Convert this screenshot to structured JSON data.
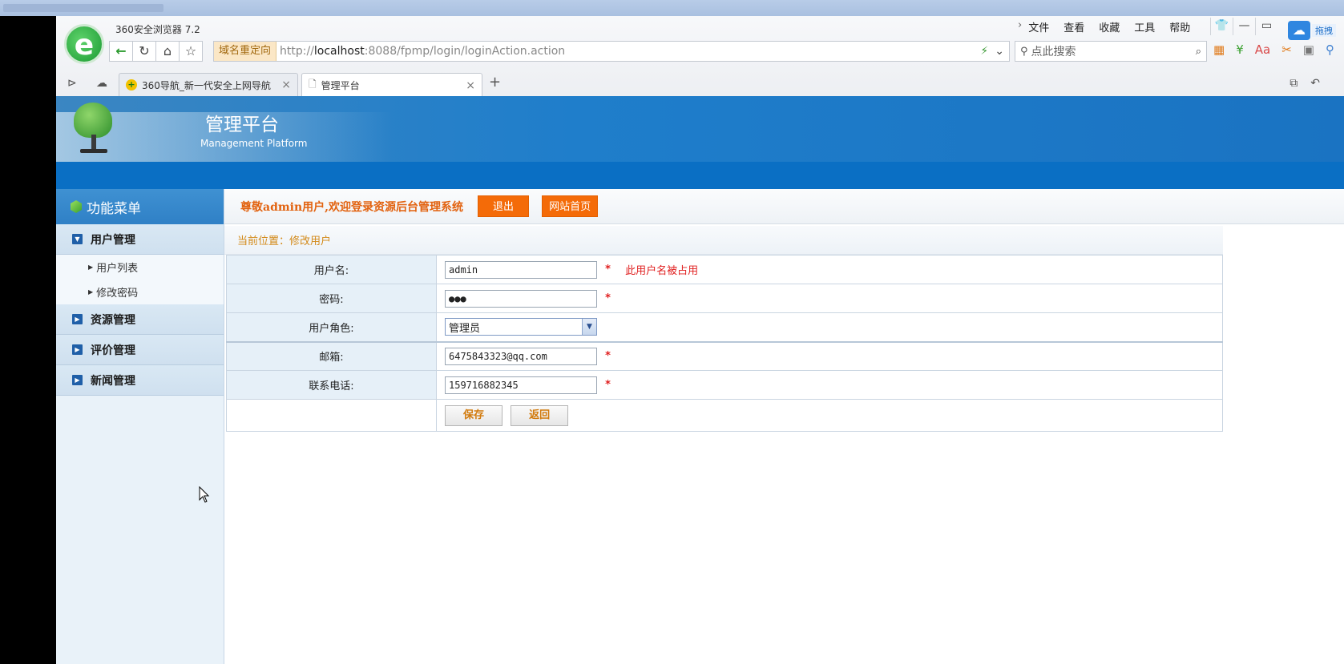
{
  "browser": {
    "app_title": "360安全浏览器 7.2",
    "menu": [
      "文件",
      "查看",
      "收藏",
      "工具",
      "帮助"
    ],
    "redirect_tag": "域名重定向",
    "url_host": "http://",
    "url_bold": "localhost",
    "url_rest": ":8088/fpmp/login/loginAction.action",
    "search_placeholder": "点此搜索",
    "drag_label": "拖拽",
    "tabs": [
      {
        "label": "360导航_新一代安全上网导航"
      },
      {
        "label": "管理平台"
      }
    ]
  },
  "banner": {
    "title": "管理平台",
    "subtitle": "Management Platform"
  },
  "sidebar": {
    "header": "功能菜单",
    "groups": [
      {
        "label": "用户管理",
        "items": [
          "用户列表",
          "修改密码"
        ]
      },
      {
        "label": "资源管理"
      },
      {
        "label": "评价管理"
      },
      {
        "label": "新闻管理"
      }
    ]
  },
  "topbar": {
    "welcome": "尊敬admin用户,欢迎登录资源后台管理系统",
    "logout": "退出",
    "home": "网站首页"
  },
  "breadcrumb": "当前位置：修改用户",
  "form": {
    "username_label": "用户名:",
    "username_value": "admin",
    "username_error": "此用户名被占用",
    "password_label": "密码:",
    "password_value": "●●●",
    "role_label": "用户角色:",
    "role_value": "管理员",
    "email_label": "邮箱:",
    "email_value": "6475843323@qq.com",
    "phone_label": "联系电话:",
    "phone_value": "159716882345",
    "required_mark": "*",
    "save": "保存",
    "back": "返回"
  }
}
